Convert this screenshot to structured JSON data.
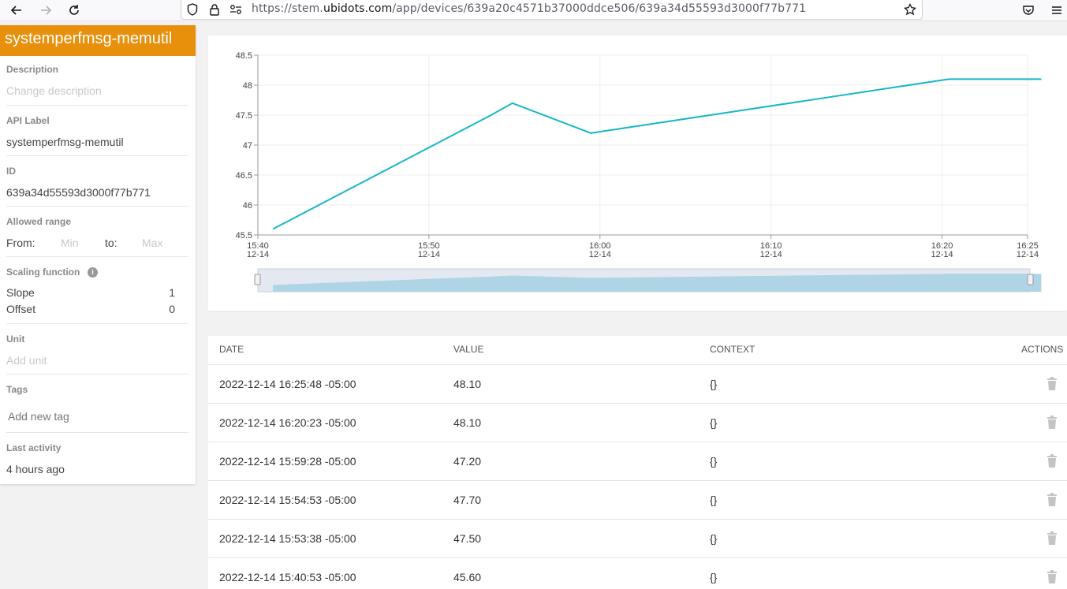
{
  "browser": {
    "url_prefix": "https://stem.",
    "url_domain": "ubidots.com",
    "url_path": "/app/devices/639a20c4571b37000ddce506/639a34d55593d3000f77b771"
  },
  "variable": {
    "name": "systemperfmsg-memutil",
    "description_label": "Description",
    "description_placeholder": "Change description",
    "api_label_title": "API Label",
    "api_label_value": "systemperfmsg-memutil",
    "id_title": "ID",
    "id_value": "639a34d55593d3000f77b771",
    "allowed_range_title": "Allowed range",
    "from_label": "From:",
    "min_placeholder": "Min",
    "to_label": "to:",
    "max_placeholder": "Max",
    "scaling_title": "Scaling function",
    "slope_label": "Slope",
    "slope_value": "1",
    "offset_label": "Offset",
    "offset_value": "0",
    "unit_title": "Unit",
    "unit_placeholder": "Add unit",
    "tags_title": "Tags",
    "tags_placeholder": "Add new tag",
    "last_activity_title": "Last activity",
    "last_activity_value": "4 hours ago"
  },
  "chart_data": {
    "type": "line",
    "x": [
      "15:40:53",
      "15:53:38",
      "15:54:53",
      "15:59:28",
      "16:20:23",
      "16:25:48"
    ],
    "series": [
      {
        "values": [
          45.6,
          47.5,
          47.7,
          47.2,
          48.1,
          48.1
        ]
      }
    ],
    "ylim": [
      45.5,
      48.5
    ],
    "yticks": [
      "45.5",
      "46",
      "46.5",
      "47",
      "47.5",
      "48",
      "48.5"
    ],
    "xticks": [
      {
        "time": "15:40",
        "date": "12-14"
      },
      {
        "time": "15:50",
        "date": "12-14"
      },
      {
        "time": "16:00",
        "date": "12-14"
      },
      {
        "time": "16:10",
        "date": "12-14"
      },
      {
        "time": "16:20",
        "date": "12-14"
      },
      {
        "time": "16:25",
        "date": "12-14"
      }
    ],
    "line_color": "#17b6c9",
    "grid": true
  },
  "table": {
    "headers": {
      "date": "DATE",
      "value": "VALUE",
      "context": "CONTEXT",
      "actions": "ACTIONS"
    },
    "rows": [
      {
        "date": "2022-12-14 16:25:48 -05:00",
        "value": "48.10",
        "context": "{}"
      },
      {
        "date": "2022-12-14 16:20:23 -05:00",
        "value": "48.10",
        "context": "{}"
      },
      {
        "date": "2022-12-14 15:59:28 -05:00",
        "value": "47.20",
        "context": "{}"
      },
      {
        "date": "2022-12-14 15:54:53 -05:00",
        "value": "47.70",
        "context": "{}"
      },
      {
        "date": "2022-12-14 15:53:38 -05:00",
        "value": "47.50",
        "context": "{}"
      },
      {
        "date": "2022-12-14 15:40:53 -05:00",
        "value": "45.60",
        "context": "{}"
      }
    ]
  },
  "colors": {
    "header_orange": "#e8900c",
    "line": "#17b6c9",
    "navigator_fill": "#aed4e6"
  }
}
